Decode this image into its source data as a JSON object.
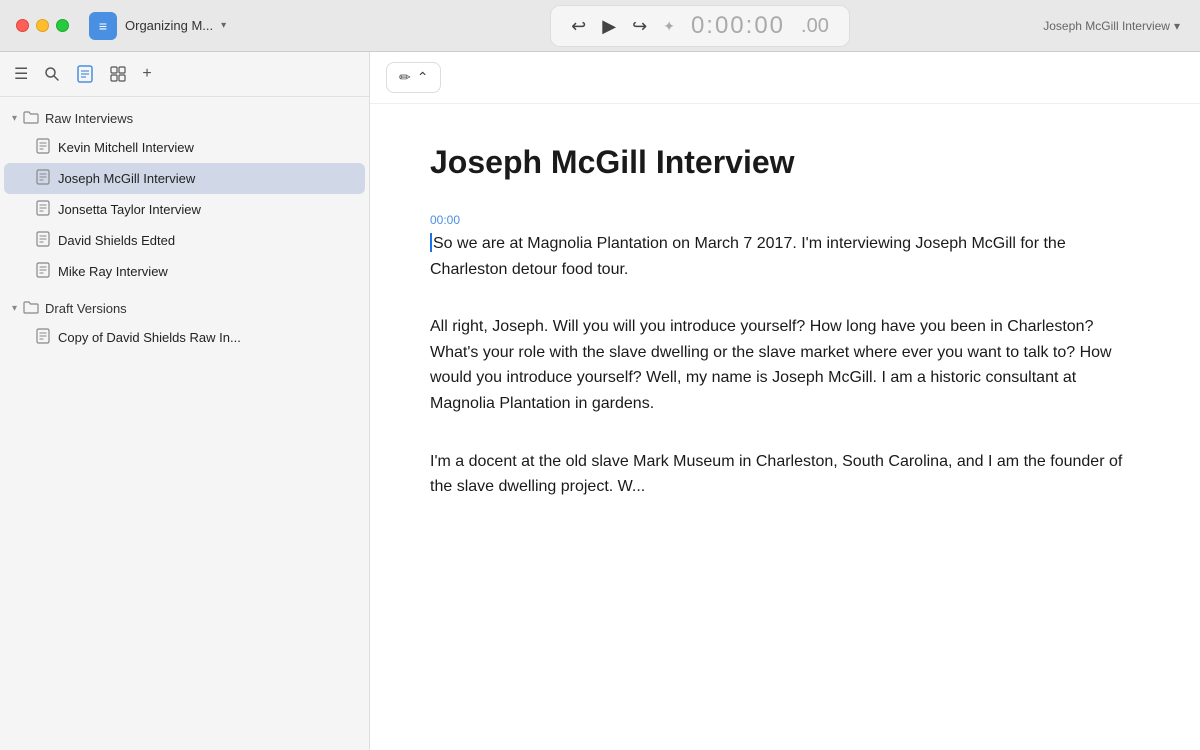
{
  "titlebar": {
    "app_name": "Organizing M...",
    "app_icon_symbol": "≡",
    "dropdown_symbol": "▾"
  },
  "transport": {
    "rewind_icon": "↩",
    "play_icon": "▶",
    "forward_icon": "↪",
    "effects_icon": "✦",
    "timecode": "0:00:00",
    "timecode_ms": ".00",
    "current_doc": "Joseph McGill Interview",
    "dropdown_symbol": "▾"
  },
  "sidebar": {
    "icons": {
      "menu": "☰",
      "search": "⌕",
      "doc": "📄",
      "grid": "⊞",
      "add": "+"
    },
    "folders": [
      {
        "id": "raw-interviews",
        "label": "Raw Interviews",
        "expanded": true,
        "docs": [
          {
            "id": "kevin-mitchell",
            "label": "Kevin Mitchell Interview",
            "active": false
          },
          {
            "id": "joseph-mcgill",
            "label": "Joseph McGill Interview",
            "active": true
          },
          {
            "id": "jonsetta-taylor",
            "label": "Jonsetta Taylor Interview",
            "active": false
          },
          {
            "id": "david-shields",
            "label": "David Shields Edted",
            "active": false
          },
          {
            "id": "mike-ray",
            "label": "Mike Ray Interview",
            "active": false
          }
        ]
      },
      {
        "id": "draft-versions",
        "label": "Draft Versions",
        "expanded": true,
        "docs": [
          {
            "id": "copy-david-shields",
            "label": "Copy of David Shields Raw In...",
            "active": false
          }
        ]
      }
    ]
  },
  "editor": {
    "mode_icon": "✏",
    "mode_toggle": "⌃",
    "doc_title": "Joseph McGill Interview",
    "blocks": [
      {
        "timecode": "00:00",
        "text": "So we are at Magnolia Plantation on March 7 2017. I'm interviewing Joseph McGill for the Charleston detour food tour."
      },
      {
        "timecode": "",
        "text": "All right, Joseph. Will you will you introduce yourself? How long have you been in Charleston? What's your role with the slave dwelling or the slave market where ever you want to talk to? How would you introduce yourself? Well, my name is Joseph McGill. I am a historic consultant at Magnolia Plantation in gardens."
      },
      {
        "timecode": "",
        "text": "I'm a docent at the old slave Mark Museum in Charleston, South Carolina, and I am the founder of the slave dwelling project. W..."
      }
    ]
  }
}
